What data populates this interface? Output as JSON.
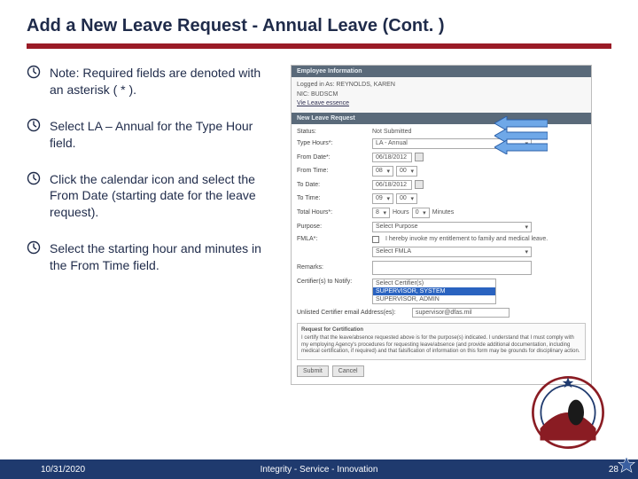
{
  "title": "Add a New Leave Request - Annual Leave (Cont. )",
  "bullets": {
    "b1": "Note:  Required fields are denoted with an asterisk ( * ).",
    "b2": "Select LA – Annual for the Type Hour field.",
    "b3": "Click the calendar icon and select the From Date (starting date for the leave request).",
    "b4": "Select the starting hour and minutes in the From Time field."
  },
  "emp": {
    "header": "Employee Information",
    "logged": "Logged in As: REYNOLDS, KAREN",
    "nic": "NIC: BUDSCM",
    "view": "Vie Leave essence"
  },
  "section": "New Leave Request",
  "form": {
    "status_lbl": "Status:",
    "status": "Not Submitted",
    "type_lbl": "Type Hours*:",
    "type": "LA - Annual",
    "from_date_lbl": "From Date*:",
    "from_date": "06/18/2012",
    "from_time_lbl": "From Time:",
    "from_h": "08",
    "from_m": "00",
    "to_date_lbl": "To Date:",
    "to_date": "06/18/2012",
    "to_time_lbl": "To Time:",
    "to_h": "09",
    "to_m": "00",
    "total_lbl": "Total Hours*:",
    "total_h": "8",
    "total_hl": "Hours",
    "total_m": "0",
    "total_ml": "Minutes",
    "purpose_lbl": "Purpose:",
    "purpose": "Select Purpose",
    "fmla_lbl": "FMLA*:",
    "fmla_chk_text": "I hereby invoke my entitlement to family and medical leave.",
    "fmla_sel": "Select FMLA",
    "remarks_lbl": "Remarks:",
    "cert_lbl": "Certifier(s) to Notify:",
    "cert_opt1": "Select Certifier(s)",
    "cert_opt2": "SUPERVISOR, SYSTEM",
    "cert_opt3": "SUPERVISOR, ADMIN",
    "unlisted_lbl": "Unlisted Certifier email Address(es):",
    "unlisted": "supervisor@dfas.mil",
    "req_title": "Request for Certification",
    "req_body": "I certify that the leave/absence requested above is for the purpose(s) indicated. I understand that I must comply with my employing Agency's procedures for requesting leave/absence (and provide additional documentation, including medical certification, if required) and that falsification of information on this form may be grounds for disciplinary action.",
    "submit": "Submit",
    "cancel": "Cancel"
  },
  "footer": {
    "date": "10/31/2020",
    "motto": "Integrity - Service - Innovation",
    "page": "28"
  }
}
